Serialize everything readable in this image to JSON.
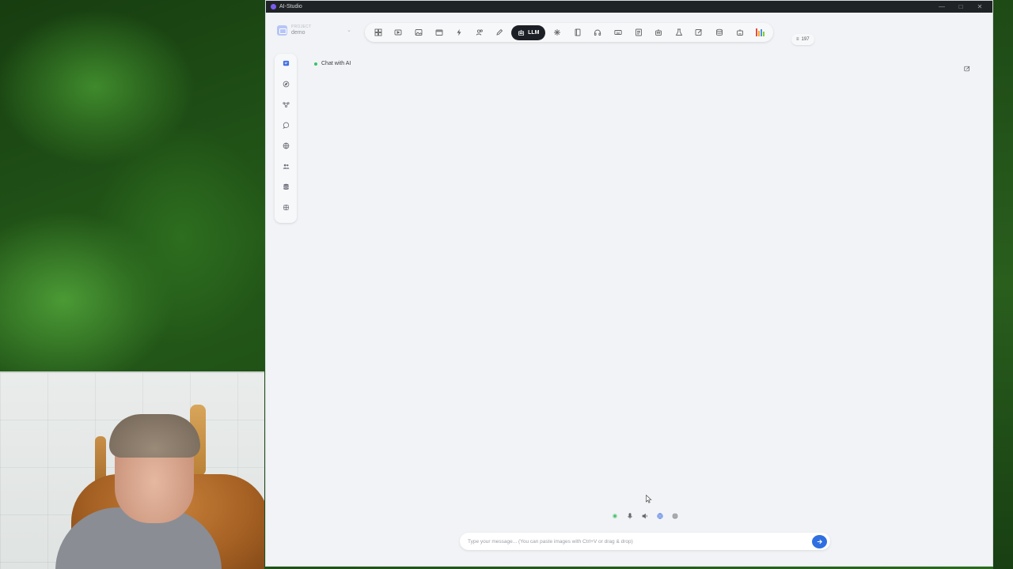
{
  "window": {
    "title": "AI-Studio",
    "controls": [
      "minimize",
      "maximize",
      "close"
    ]
  },
  "project": {
    "label": "PROJECT",
    "name": "demo"
  },
  "toolbar": {
    "icons": [
      "dashboard-icon",
      "video-icon",
      "image-icon",
      "film-icon",
      "lightning-icon",
      "users-icon",
      "pen-icon"
    ],
    "active_label": "LLM",
    "icons_after": [
      "sparkle-icon",
      "book-icon",
      "headphones-icon",
      "keyboard-icon",
      "document-icon",
      "robot-icon",
      "flask-icon",
      "edit-square-icon",
      "database-icon",
      "robot-alt-icon"
    ],
    "colorbar_colors": [
      "#e94b3c",
      "#f5a623",
      "#4a90e2",
      "#7ed321"
    ]
  },
  "credits": {
    "value": "197"
  },
  "sidebar": {
    "items": [
      "chat-icon",
      "compass-icon",
      "workflow-icon",
      "message-circle-icon",
      "globe-icon",
      "team-icon",
      "database-icon",
      "plugin-icon"
    ],
    "active_color": "#3d6fe0"
  },
  "chat": {
    "title": "Chat with AI"
  },
  "input_tools": [
    "status-dot-icon",
    "microphone-icon",
    "speaker-icon",
    "globe-icon",
    "settings-icon"
  ],
  "message": {
    "placeholder": "Type your message... (You can paste images with Ctrl+V or drag & drop)"
  },
  "colors": {
    "accent": "#2f6fe0",
    "active_tab_bg": "#1c1f26",
    "status_green": "#33c46a"
  }
}
